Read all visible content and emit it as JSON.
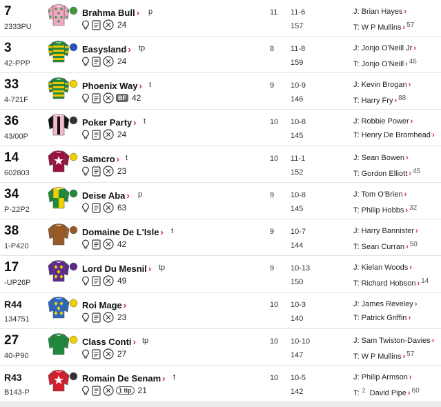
{
  "runners": [
    {
      "num": "7",
      "form": "2333PU",
      "name": "Brahma Bull",
      "gear": "p",
      "rating": "24",
      "age": "11",
      "weight": "11-6",
      "or": "157",
      "jockey": "J: Brian Hayes",
      "trainer": "T: W P Mullins",
      "trainer_pct": "57",
      "silk": {
        "body": "#f2a6c4",
        "dots": "#3a9a3c",
        "sleeve": "#f2a6c4",
        "cap": "#3a9a3c"
      }
    },
    {
      "num": "3",
      "form": "42-PPP",
      "name": "Easysland",
      "gear": "tp",
      "rating": "24",
      "age": "8",
      "weight": "11-8",
      "or": "159",
      "jockey": "J: Jonjo O'Neill Jr",
      "trainer": "T: Jonjo O'Neill",
      "trainer_pct": "46",
      "silk": {
        "body": "#1f8a3c",
        "hoops": "#f2c400",
        "sleeve": "#1f8a3c",
        "cap": "#2a55b8"
      }
    },
    {
      "num": "33",
      "form": "4-721F",
      "name": "Phoenix Way",
      "gear": "t",
      "rating": "42",
      "bf": "BF",
      "age": "9",
      "weight": "10-9",
      "or": "146",
      "jockey": "J: Kevin Brogan",
      "trainer": "T: Harry Fry",
      "trainer_pct": "88",
      "silk": {
        "body": "#1f8a3c",
        "hoops": "#f2c400",
        "sleeve": "#1f8a3c",
        "cap": "#f2d000"
      }
    },
    {
      "num": "36",
      "form": "43/00P",
      "name": "Poker Party",
      "gear": "t",
      "rating": "24",
      "age": "10",
      "weight": "10-8",
      "or": "145",
      "jockey": "J: Robbie Power",
      "trainer": "T: Henry De Bromhead",
      "trainer_pct": "",
      "silk": {
        "body": "#f4b8c8",
        "stripe": "#111",
        "sleeve": "#111",
        "cap": "#333"
      }
    },
    {
      "num": "14",
      "form": "602803",
      "name": "Samcro",
      "gear": "t",
      "rating": "23",
      "age": "10",
      "weight": "11-1",
      "or": "152",
      "jockey": "J: Sean Bowen",
      "trainer": "T: Gordon Elliott",
      "trainer_pct": "45",
      "silk": {
        "body": "#9b1040",
        "star": "#fff",
        "sleeve": "#9b1040",
        "cap": "#f2d000"
      }
    },
    {
      "num": "34",
      "form": "P-22P2",
      "name": "Deise Aba",
      "gear": "p",
      "rating": "63",
      "age": "9",
      "weight": "10-8",
      "or": "145",
      "jockey": "J: Tom O'Brien",
      "trainer": "T: Philip Hobbs",
      "trainer_pct": "32",
      "silk": {
        "body": "#f2d000",
        "quarter": "#1f8a3c",
        "sleeve": "#1f8a3c",
        "cap": "#1f8a3c"
      }
    },
    {
      "num": "38",
      "form": "1-P420",
      "name": "Domaine De L'Isle",
      "gear": "t",
      "rating": "42",
      "age": "9",
      "weight": "10-7",
      "or": "144",
      "jockey": "J: Harry Bannister",
      "trainer": "T: Sean Curran",
      "trainer_pct": "50",
      "silk": {
        "body": "#9a5a26",
        "sleeve": "#9a5a26",
        "cap": "#9a5a26"
      }
    },
    {
      "num": "17",
      "form": "-UP26P",
      "name": "Lord Du Mesnil",
      "gear": "tp",
      "rating": "49",
      "age": "9",
      "weight": "10-13",
      "or": "150",
      "jockey": "J: Kielan Woods",
      "trainer": "T: Richard Hobson",
      "trainer_pct": "14",
      "silk": {
        "body": "#5b2a8f",
        "diamond": "#f2d000",
        "sleeve": "#5b2a8f",
        "cap": "#5b2a8f"
      }
    },
    {
      "num": "R44",
      "form": "134751",
      "name": "Roi Mage",
      "gear": "",
      "rating": "23",
      "age": "10",
      "weight": "10-3",
      "or": "140",
      "jockey": "J: James Reveley",
      "trainer": "T: Patrick Griffin",
      "trainer_pct": "",
      "silk": {
        "body": "#2b68c4",
        "diamond": "#f2d000",
        "sleeve": "#2b68c4",
        "cap": "#f2d000"
      }
    },
    {
      "num": "27",
      "form": "40-P90",
      "name": "Class Conti",
      "gear": "tp",
      "rating": "27",
      "age": "10",
      "weight": "10-10",
      "or": "147",
      "jockey": "J: Sam Twiston-Davies",
      "trainer": "T: W P Mullins",
      "trainer_pct": "57",
      "silk": {
        "body": "#1f8a3c",
        "sleeve": "#1f8a3c",
        "cap": "#f2d000"
      }
    },
    {
      "num": "R43",
      "form": "B143-P",
      "name": "Romain De Senam",
      "gear": "t",
      "rating": "21",
      "tip": "1 tip",
      "age": "10",
      "weight": "10-5",
      "or": "142",
      "jockey": "J: Philip Armson",
      "trainer": "T:",
      "trainer_badge": "2",
      "trainer_name": "David Pipe",
      "trainer_pct": "60",
      "silk": {
        "body": "#d51e2b",
        "star": "#fff",
        "sleeve": "#d51e2b",
        "cap": "#333"
      }
    }
  ],
  "colors": {
    "accent": "#d51e3b",
    "divider": "#e3e3e3"
  }
}
